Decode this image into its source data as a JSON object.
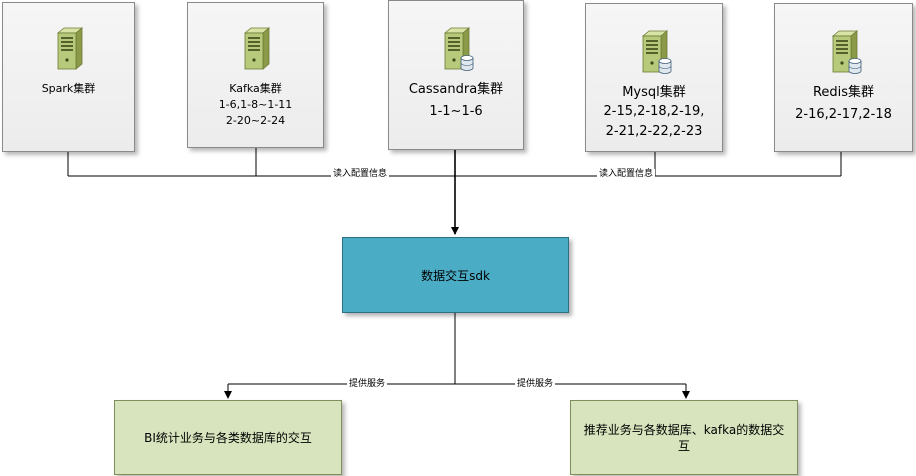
{
  "clusters": [
    {
      "name": "Spark集群",
      "lines": []
    },
    {
      "name": "Kafka集群",
      "lines": [
        "1-6,1-8~1-11",
        "2-20~2-24"
      ]
    },
    {
      "name": "Cassandra集群",
      "lines": [
        "1-1~1-6"
      ]
    },
    {
      "name": "Mysql集群",
      "lines": [
        "2-15,2-18,2-19,",
        "2-21,2-22,2-23"
      ]
    },
    {
      "name": "Redis集群",
      "lines": [
        "2-16,2-17,2-18"
      ]
    }
  ],
  "edges": {
    "read_config_left": "读入配置信息",
    "read_config_right": "读入配置信息",
    "provide_left": "提供服务",
    "provide_right": "提供服务"
  },
  "sdk": {
    "label": "数据交互sdk"
  },
  "consumers": {
    "bi": "BI统计业务与各类数据库的交互",
    "recommend": "推荐业务与各数据库、kafka的数据交互"
  },
  "colors": {
    "sdk": "#4bacc6",
    "consumer": "#d7e4bd",
    "server": "#b7c97a"
  }
}
